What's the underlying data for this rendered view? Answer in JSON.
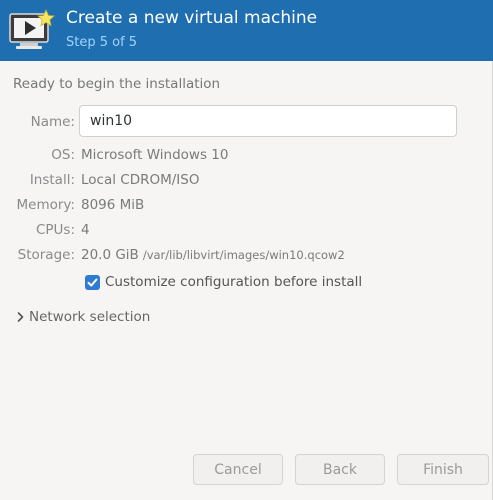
{
  "header": {
    "title": "Create a new virtual machine",
    "step": "Step 5 of 5",
    "icon": "virtual-machine-new-icon"
  },
  "summary": {
    "section_title": "Ready to begin the installation",
    "name_label": "Name:",
    "name_value": "win10",
    "os_label": "OS:",
    "os_value": "Microsoft Windows 10",
    "install_label": "Install:",
    "install_value": "Local CDROM/ISO",
    "memory_label": "Memory:",
    "memory_value": "8096 MiB",
    "cpus_label": "CPUs:",
    "cpus_value": "4",
    "storage_label": "Storage:",
    "storage_size": "20.0 GiB",
    "storage_path": "/var/lib/libvirt/images/win10.qcow2"
  },
  "customize": {
    "label": "Customize configuration before install",
    "checked": true
  },
  "network": {
    "label": "Network selection",
    "expanded": false,
    "icon": "chevron-right-icon"
  },
  "buttons": {
    "cancel": "Cancel",
    "back": "Back",
    "finish": "Finish"
  },
  "colors": {
    "header_bg": "#1f6fb0",
    "accent": "#2f7bd2"
  }
}
